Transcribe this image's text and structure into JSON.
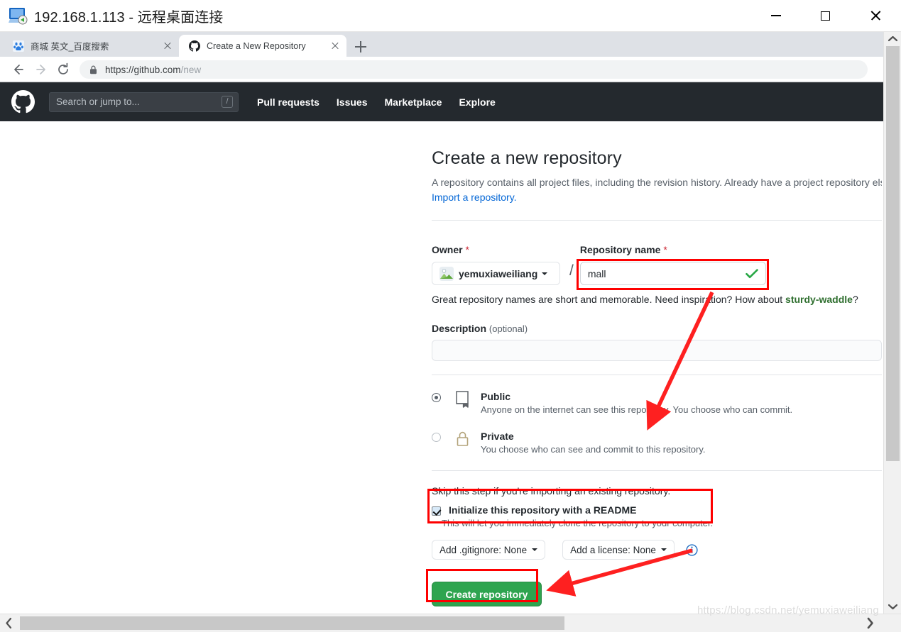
{
  "window": {
    "title": "192.168.1.113 - 远程桌面连接",
    "icon": "remote-desktop-icon",
    "minimize_label": "Minimize",
    "maximize_label": "Maximize",
    "close_label": "Close"
  },
  "browser": {
    "tabs": [
      {
        "title": "商城 英文_百度搜索",
        "favicon": "baidu-icon",
        "active": false
      },
      {
        "title": "Create a New Repository",
        "favicon": "github-icon",
        "active": true
      }
    ],
    "new_tab_label": "+",
    "url_domain": "https://github.com",
    "url_path": "/new",
    "lock_icon": "lock-icon",
    "back_label": "Back",
    "forward_label": "Forward",
    "reload_label": "Reload"
  },
  "github_header": {
    "logo": "github-mark-icon",
    "search_placeholder": "Search or jump to...",
    "search_shortcut": "/",
    "nav": [
      "Pull requests",
      "Issues",
      "Marketplace",
      "Explore"
    ]
  },
  "main": {
    "heading": "Create a new repository",
    "subtitle": "A repository contains all project files, including the revision history. Already have a project repository els",
    "import_link": "Import a repository.",
    "owner": {
      "label": "Owner",
      "required_mark": "*",
      "name": "yemuxiaweiliang",
      "avatar": "user-avatar"
    },
    "separator": "/",
    "repository_name": {
      "label": "Repository name",
      "required_mark": "*",
      "value": "mall",
      "valid_icon": "check-icon"
    },
    "name_hint_prefix": "Great repository names are short and memorable. Need inspiration? How about ",
    "name_hint_suggestion": "sturdy-waddle",
    "name_hint_suffix": "?",
    "description": {
      "label": "Description",
      "optional": "(optional)",
      "value": ""
    },
    "visibility": [
      {
        "name": "Public",
        "description": "Anyone on the internet can see this repository. You choose who can commit.",
        "selected": true,
        "icon": "repo-book-icon"
      },
      {
        "name": "Private",
        "description": "You choose who can see and commit to this repository.",
        "selected": false,
        "icon": "lock-icon"
      }
    ],
    "skip_note": "Skip this step if you're importing an existing repository.",
    "readme": {
      "label": "Initialize this repository with a README",
      "description": "This will let you immediately clone the repository to your computer.",
      "checked": true
    },
    "gitignore_dropdown": "Add .gitignore: None",
    "license_dropdown": "Add a license: None",
    "info_icon": "info-icon",
    "create_button": "Create repository"
  },
  "watermark": "https://blog.csdn.net/yemuxiaweiliang",
  "colors": {
    "accent_green": "#2ea44f",
    "annotation_red": "#fe0000",
    "link_blue": "#0366d6",
    "header_dark": "#24292e",
    "suggestion_green": "#2f6f2f"
  }
}
